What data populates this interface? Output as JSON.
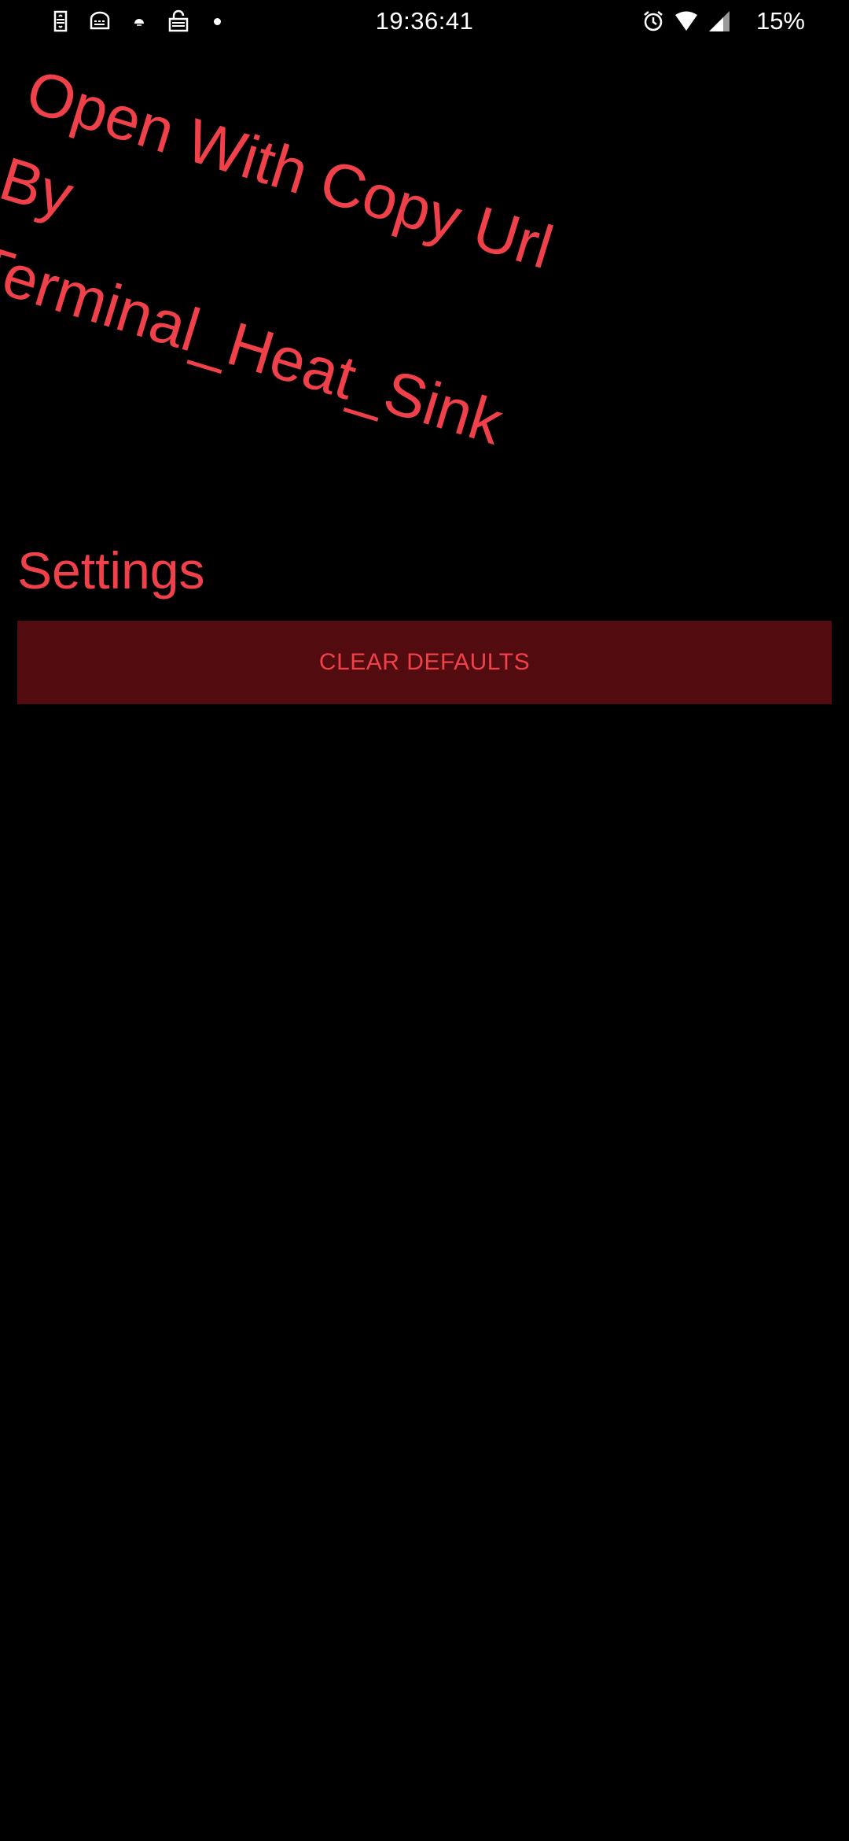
{
  "status_bar": {
    "time": "19:36:41",
    "battery": "15%",
    "left_icons": [
      "sim-icon",
      "keyboard-icon",
      "weather-icon",
      "vpn-lock-icon",
      "notification-dot-icon"
    ],
    "right_icons": [
      "alarm-icon",
      "wifi-icon",
      "signal-icon"
    ]
  },
  "banner": {
    "line1": "Open With Copy Url",
    "line2": "By",
    "line3": "Terminal_Heat_Sink"
  },
  "settings": {
    "title": "Settings",
    "clear_defaults_label": "CLEAR DEFAULTS"
  },
  "colors": {
    "background": "#000000",
    "accent": "#f0404a",
    "button_bg": "#520b0f"
  }
}
